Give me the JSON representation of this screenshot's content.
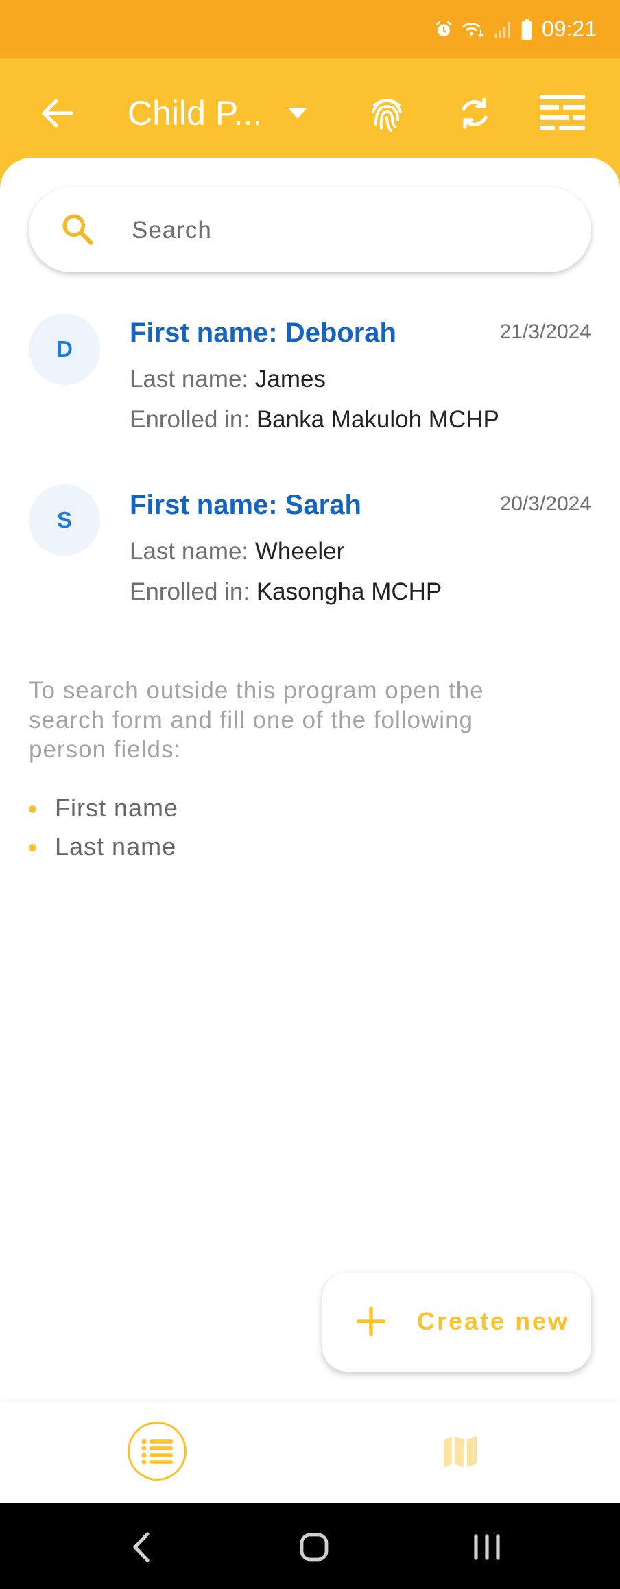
{
  "status_bar": {
    "time": "09:21",
    "icons": [
      "alarm-icon",
      "wifi-calling-icon",
      "signal-icon",
      "battery-icon"
    ]
  },
  "toolbar": {
    "title": "Child P...",
    "icons": [
      "back-arrow-icon",
      "dropdown-caret-icon",
      "fingerprint-icon",
      "sync-icon",
      "filter-icon"
    ]
  },
  "search": {
    "placeholder": "Search"
  },
  "records": [
    {
      "avatar_letter": "D",
      "first_name_label": "First name: Deborah",
      "date": "21/3/2024",
      "last_name_label": "Last name:",
      "last_name": "James",
      "enrolled_label": "Enrolled in:",
      "enrolled_in": "Banka Makuloh MCHP"
    },
    {
      "avatar_letter": "S",
      "first_name_label": "First name: Sarah",
      "date": "20/3/2024",
      "last_name_label": "Last name:",
      "last_name": "Wheeler",
      "enrolled_label": "Enrolled in:",
      "enrolled_in": "Kasongha MCHP"
    }
  ],
  "hint": {
    "text": "To search outside this program open the search form and fill one of the following person fields:",
    "fields": [
      "First name",
      "Last name"
    ]
  },
  "fab": {
    "label": "Create new"
  },
  "bottom_nav": {
    "items": [
      "list-view-icon",
      "map-view-icon"
    ]
  },
  "colors": {
    "status_bar": "#f8a81f",
    "toolbar": "#fcc12f",
    "accent_blue": "#1565c0"
  }
}
